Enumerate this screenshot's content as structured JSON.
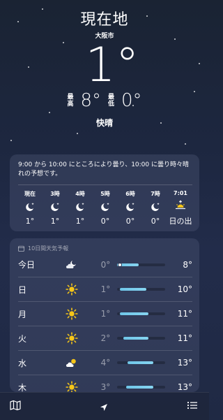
{
  "hero": {
    "location": "現在地",
    "sublocation": "大阪市",
    "temperature": "1°",
    "high_label_top": "最",
    "high_label_bottom": "高",
    "high": "8°",
    "low_label_top": "最",
    "low_label_bottom": "低",
    "low": "0°",
    "condition": "快晴"
  },
  "hourly": {
    "summary": "9:00 から 10:00 にところにより曇り、10:00 に曇り時々晴れの予想です。",
    "items": [
      {
        "hour": "現在",
        "icon": "moon-stars-icon",
        "temp": "1°"
      },
      {
        "hour": "3時",
        "icon": "moon-stars-icon",
        "temp": "1°"
      },
      {
        "hour": "4時",
        "icon": "moon-stars-icon",
        "temp": "1°"
      },
      {
        "hour": "5時",
        "icon": "moon-stars-icon",
        "temp": "0°"
      },
      {
        "hour": "6時",
        "icon": "moon-stars-icon",
        "temp": "0°"
      },
      {
        "hour": "7時",
        "icon": "moon-stars-icon",
        "temp": "0°"
      },
      {
        "hour": "7:01",
        "icon": "sunrise-icon",
        "temp": "日の出"
      }
    ]
  },
  "daily": {
    "header": "10日間天気予報",
    "rows": [
      {
        "day": "今日",
        "icon": "moon-cloud-icon",
        "low": "0°",
        "high": "8°",
        "bar_start": 0.0,
        "bar_end": 0.45,
        "current": 0.05
      },
      {
        "day": "日",
        "icon": "sun-icon",
        "low": "1°",
        "high": "10°",
        "bar_start": 0.06,
        "bar_end": 0.6
      },
      {
        "day": "月",
        "icon": "sun-icon",
        "low": "1°",
        "high": "11°",
        "bar_start": 0.06,
        "bar_end": 0.65
      },
      {
        "day": "火",
        "icon": "sun-icon",
        "low": "2°",
        "high": "11°",
        "bar_start": 0.12,
        "bar_end": 0.65
      },
      {
        "day": "水",
        "icon": "sun-cloud-icon",
        "low": "4°",
        "high": "13°",
        "bar_start": 0.22,
        "bar_end": 0.75
      },
      {
        "day": "木",
        "icon": "sun-icon",
        "low": "3°",
        "high": "13°",
        "bar_start": 0.18,
        "bar_end": 0.75
      }
    ]
  },
  "colors": {
    "sun": "#f5c518",
    "bar": "#6fc6e8"
  }
}
